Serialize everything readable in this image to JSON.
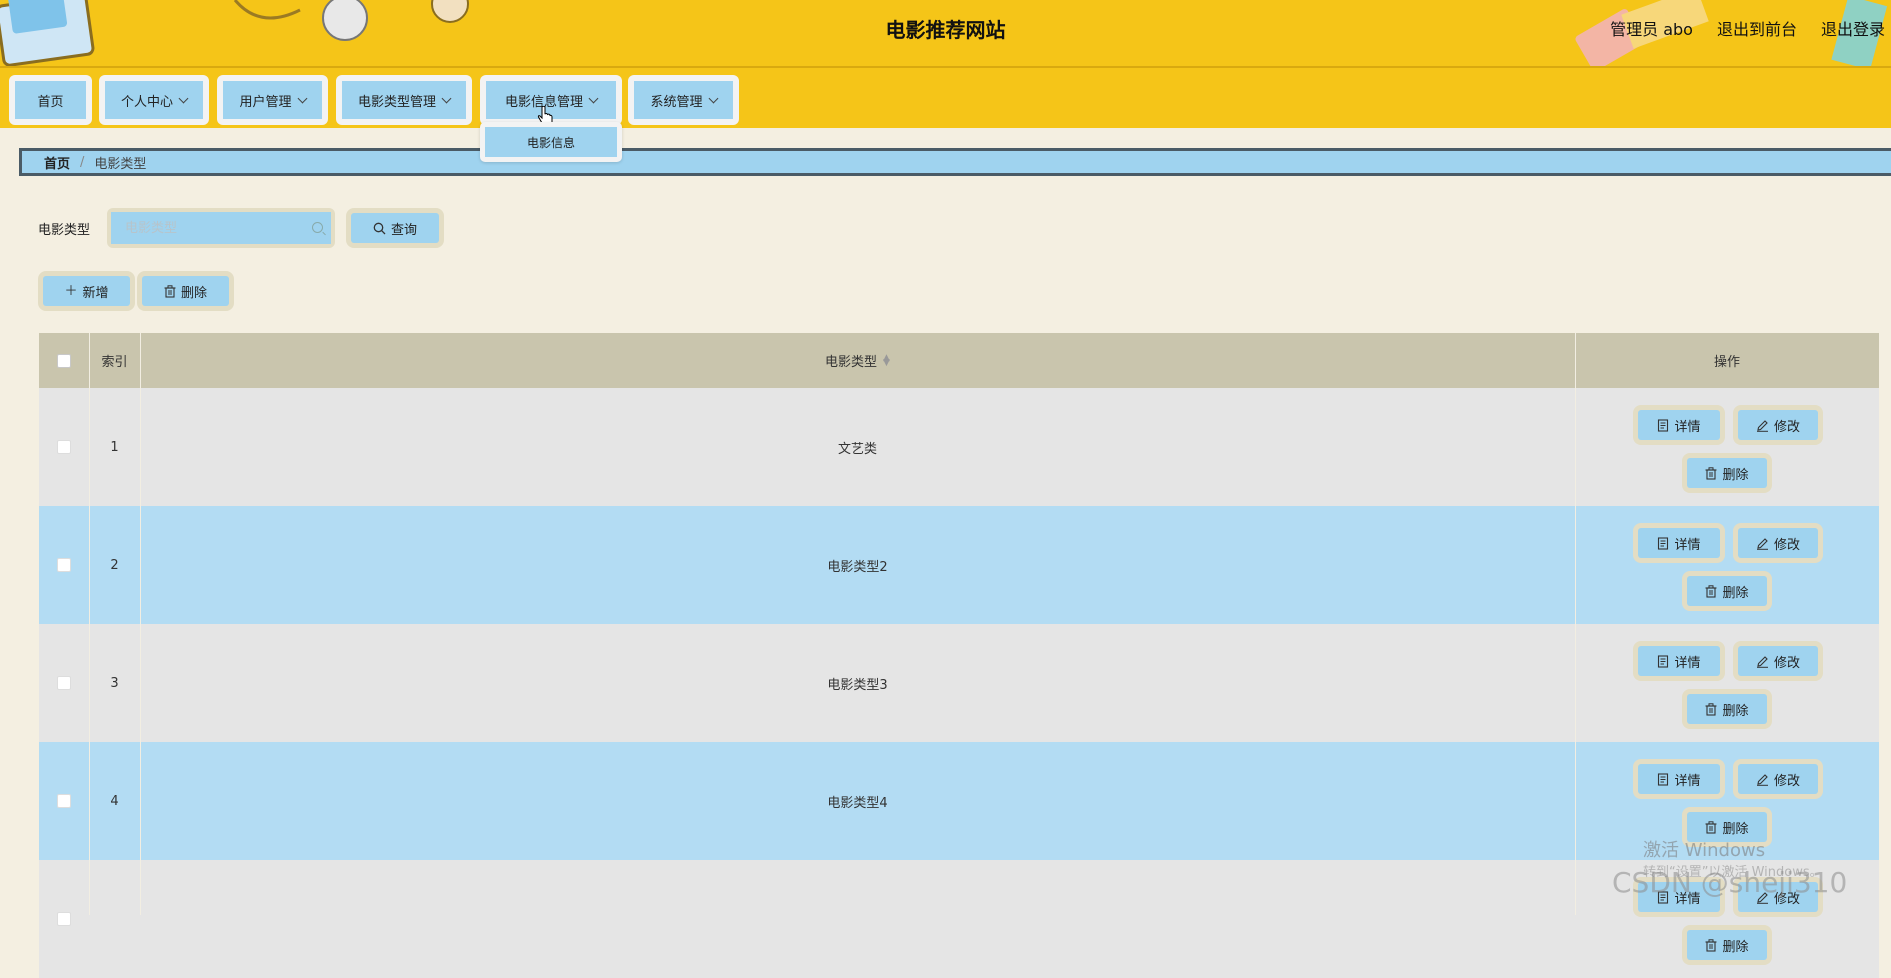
{
  "header": {
    "title": "电影推荐网站",
    "admin_label": "管理员 abo",
    "back_to_front": "退出到前台",
    "logout": "退出登录"
  },
  "nav": {
    "items": [
      {
        "label": "首页",
        "has_dropdown": false
      },
      {
        "label": "个人中心",
        "has_dropdown": true
      },
      {
        "label": "用户管理",
        "has_dropdown": true
      },
      {
        "label": "电影类型管理",
        "has_dropdown": true
      },
      {
        "label": "电影信息管理",
        "has_dropdown": true
      },
      {
        "label": "系统管理",
        "has_dropdown": true
      }
    ],
    "dropdown_open": {
      "parent": "电影信息管理",
      "items": [
        "电影信息"
      ]
    }
  },
  "breadcrumb": {
    "home": "首页",
    "separator": "/",
    "current": "电影类型"
  },
  "search": {
    "label": "电影类型",
    "placeholder": "电影类型",
    "value": "",
    "button": "查询"
  },
  "toolbar": {
    "add": "新增",
    "delete": "删除"
  },
  "table": {
    "columns": [
      "索引",
      "电影类型",
      "操作"
    ],
    "rows": [
      {
        "index": "1",
        "type": "文艺类"
      },
      {
        "index": "2",
        "type": "电影类型2"
      },
      {
        "index": "3",
        "type": "电影类型3"
      },
      {
        "index": "4",
        "type": "电影类型4"
      },
      {
        "index": "",
        "type": ""
      }
    ],
    "actions": {
      "detail": "详情",
      "edit": "修改",
      "delete": "删除"
    }
  },
  "watermark": {
    "line1": "激活 Windows",
    "line2": "转到“设置”以激活 Windows。",
    "credit": "CSDN @sheji310"
  },
  "colors": {
    "header_bg": "#f5c518",
    "page_bg": "#f4efe1",
    "button_bg": "#9fd3ef",
    "table_header_bg": "#c9c5ad",
    "row_even": "#e5e5e5",
    "row_odd": "#b3dcf3"
  }
}
